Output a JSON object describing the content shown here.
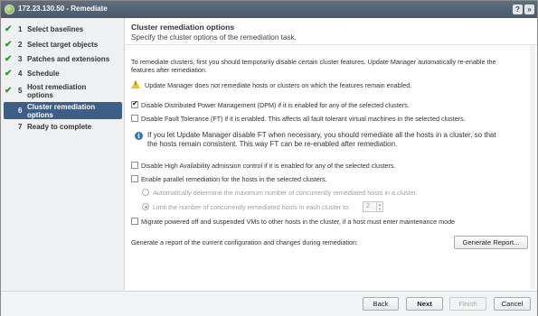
{
  "titlebar": {
    "title": "172.23.130.50 - Remediate",
    "help_label": "?",
    "close_label": "»"
  },
  "sidebar": {
    "steps": [
      {
        "num": "1",
        "label": "Select baselines",
        "done": true
      },
      {
        "num": "2",
        "label": "Select target objects",
        "done": true
      },
      {
        "num": "3",
        "label": "Patches and extensions",
        "done": true
      },
      {
        "num": "4",
        "label": "Schedule",
        "done": true
      },
      {
        "num": "5",
        "label_line1": "Host remediation",
        "label_line2": "options",
        "done": true
      },
      {
        "num": "6",
        "label_line1": "Cluster remediation",
        "label_line2": "options",
        "active": true
      },
      {
        "num": "7",
        "label": "Ready to complete"
      }
    ]
  },
  "header": {
    "title": "Cluster remediation options",
    "subtitle": "Specify the cluster options of the remediation task."
  },
  "main": {
    "intro_line1": "To remediate clusters, first you should temporarily disable certain cluster features. Update Manager automatically re-enable the",
    "intro_line2": "features after remediation.",
    "warning": "Update Manager does not remediate hosts or clusters on which the features remain enabled.",
    "opt_dpm": "Disable Distributed Power Management (DPM) if it is enabled for any of the selected clusters.",
    "opt_ft": "Disable Fault Tolerance (FT) if it is enabled. This affects all fault tolerant virtual machines in the selected clusters.",
    "info_line1": "If you let Update Manager disable FT when necessary, you should remediate all the hosts in a cluster, so that",
    "info_line2": "the hosts remain consistent. This way FT can be re-enabled after remediation.",
    "opt_ha": "Disable High Availability admission control if it is enabled for any of the selected clusters.",
    "opt_parallel": "Enable parallel remediation for the hosts in the selected clusters.",
    "radio_auto": "Automatically determine the maximum number of concurrently remediated hosts in a cluster.",
    "radio_limit": "Limit the number of concurrently remediated hosts in each cluster to:",
    "limit_value": "2",
    "opt_migrate": "Migrate powered off and suspended VMs to other hosts in the cluster, if a host must enter maintenance mode",
    "report_label": "Generate a report of the current configuration and changes during remediation:",
    "report_button": "Generate Report..."
  },
  "footer": {
    "back": "Back",
    "next": "Next",
    "finish": "Finish",
    "cancel": "Cancel"
  },
  "colors": {
    "titlebar": "#4f5e6d",
    "active_step": "#3d5f86",
    "check": "#2a9a2a",
    "warning": "#f2c21b",
    "info": "#2f72c0"
  }
}
